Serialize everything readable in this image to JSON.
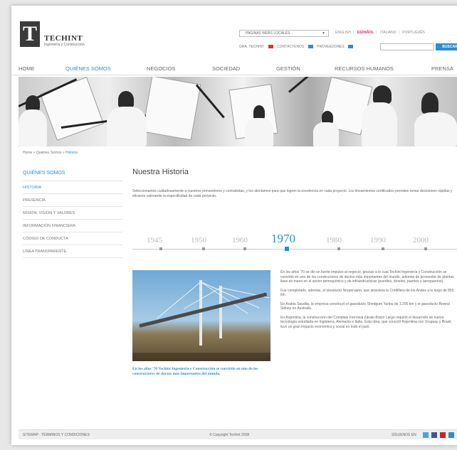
{
  "brand": {
    "logo_letter": "T",
    "name": "TECHINT",
    "tagline": "Ingeniería y Construcción"
  },
  "header": {
    "local_pages_select": "PAGINAS WEBS LOCALES",
    "languages": [
      "ENGLISH",
      "ESPAÑOL",
      "ITALIANO",
      "PORTUGUÊS"
    ],
    "active_language": "ESPAÑOL",
    "utility_links": [
      "GRA. TECHINT",
      "CONTÁCTENOS",
      "PROVEEDORES"
    ],
    "search_button": "BUSCAR"
  },
  "nav": {
    "items": [
      "HOME",
      "QUIÉNES SOMOS",
      "NEGOCIOS",
      "SOCIEDAD",
      "GESTIÓN",
      "RECURSOS HUMANOS",
      "PRENSA"
    ],
    "active": "QUIÉNES SOMOS"
  },
  "breadcrumb": {
    "parents": "Home » Quiénes Somos » ",
    "current": "Historia"
  },
  "sidebar": {
    "title": "QUIÉNES SOMOS",
    "items": [
      "HISTORIA",
      "PRESENCIA",
      "MISIÓN, VISIÓN Y VALORES",
      "INFORMACIÓN FINANCIERA",
      "CÓDIGO DE CONDUCTA",
      "LÍNEA TRANSPARENTE"
    ],
    "active": "HISTORIA"
  },
  "main": {
    "title": "Nuestra Historia",
    "intro": "Seleccionamos cuidadosamente a nuestros proveedores y contratistas, y los alentamos para que logren la excelencia en cada proyecto. Los lineamientos certificados permiten tomar decisiones rápidas y eficaces valorando la especificidad de cada proyecto.",
    "timeline": [
      "1945",
      "1950",
      "1960",
      "1970",
      "1980",
      "1990",
      "2000"
    ],
    "active_year": "1970",
    "photo_caption": "En los años '70 Techint Ingeniería y Construcción se convirtió en uno de los constructores de ductos más importantes del mundo.",
    "article": [
      "En los años '70 se dio un fuerte impulso al negocio, gracias a lo cual Techint Ingeniería y Construcción se convirtió en uno de los constructores de ductos más importantes del mundo, además de proveedor de plantas llave en mano en el sector petroquímico y de infraestructuras (puentes, túneles, puertos y aeropuertos).",
      "Fue completado, además, el oleoducto Norperuano, que atraviesa la Cordillera de los Andes a lo largo de 850 km.",
      "En Arabia Saudita, la empresa construyó el gasoducto Shedgum Yanbu de 1.200 km y el gasoducto Bowral Sidney en Australia.",
      "En Argentina, la construcción del Complejo Ferrovial Zárate Brazo Largo requirió el desarrollo de nueva tecnología estudiada en Inglaterra, Alemania e Italia. Esta obra, que conectó Argentina con Uruguay y Brasil, tuvo un gran impacto económico y social en todo el país."
    ]
  },
  "footer": {
    "links": "SITEMAP - TÉRMINOS Y CONDICIONES",
    "copyright": "© Copyright Techint 2008",
    "follow": "SÍGUENOS EN"
  },
  "colors": {
    "accent": "#2a8fd0",
    "active_language": "#e0306a"
  }
}
